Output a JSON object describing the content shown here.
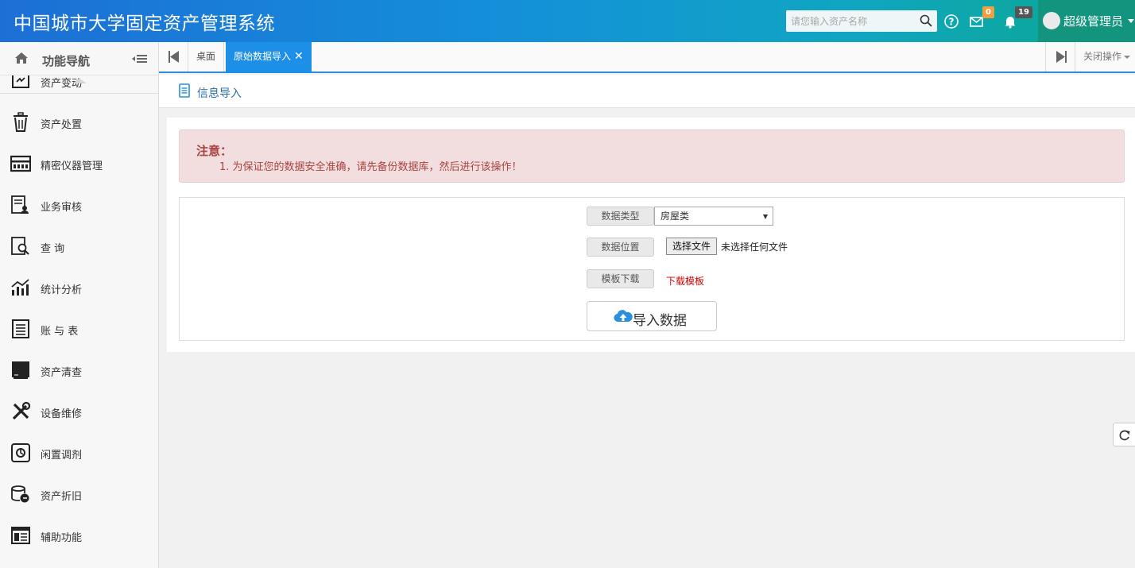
{
  "app": {
    "title": "中国城市大学固定资产管理系统"
  },
  "header": {
    "search_placeholder": "请您输入资产名称",
    "mail_badge": "0",
    "notify_badge": "19",
    "user_name": "超级管理员"
  },
  "sidebar": {
    "title": "功能导航",
    "items": [
      {
        "label": "资产变动",
        "icon": "asset-change-icon"
      },
      {
        "label": "资产处置",
        "icon": "trash-icon"
      },
      {
        "label": "精密仪器管理",
        "icon": "instrument-icon"
      },
      {
        "label": "业务审核",
        "icon": "audit-icon"
      },
      {
        "label": "查 询",
        "icon": "query-icon"
      },
      {
        "label": "统计分析",
        "icon": "stats-icon"
      },
      {
        "label": "账 与 表",
        "icon": "ledger-icon"
      },
      {
        "label": "资产清查",
        "icon": "inventory-icon"
      },
      {
        "label": "设备维修",
        "icon": "repair-icon"
      },
      {
        "label": "闲置调剂",
        "icon": "idle-icon"
      },
      {
        "label": "资产折旧",
        "icon": "depreciation-icon"
      },
      {
        "label": "辅助功能",
        "icon": "aux-icon"
      }
    ]
  },
  "tabs": {
    "desk": "桌面",
    "active": "原始数据导入",
    "close_label": "✕",
    "close_ops": "关闭操作"
  },
  "content": {
    "title": "信息导入",
    "alert_title": "注意：",
    "alert_text": "1. 为保证您的数据安全准确，请先备份数据库，然后进行该操作！",
    "form": {
      "type_label": "数据类型",
      "type_value": "房屋类",
      "location_label": "数据位置",
      "file_button": "选择文件",
      "file_status": "未选择任何文件",
      "template_label": "模板下载",
      "template_link": "下载模板",
      "import_button": "导入数据"
    }
  },
  "colors": {
    "accent": "#1e8fe6",
    "alert_bg": "#f2dede",
    "alert_text": "#a94442",
    "link_red": "#d00000"
  }
}
